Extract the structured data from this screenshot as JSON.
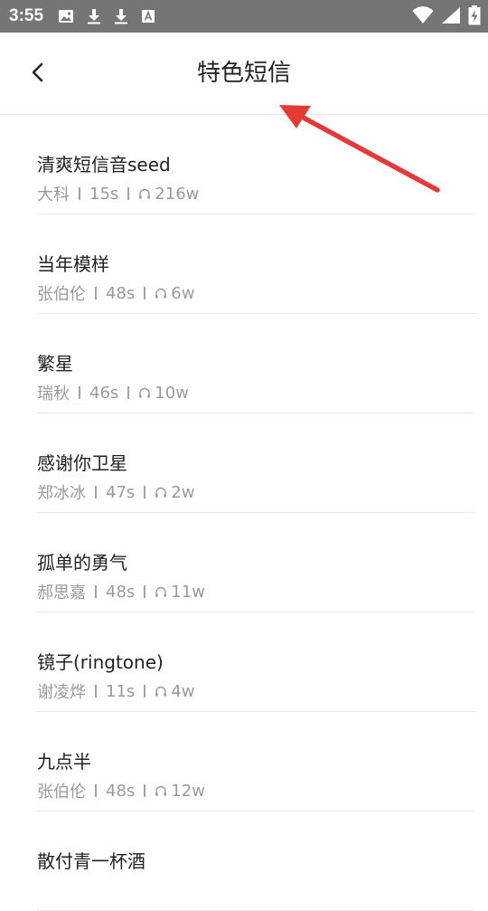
{
  "status_bar": {
    "time": "3:55",
    "left_icons": [
      "image-icon",
      "download-icon",
      "download-icon",
      "font-icon"
    ],
    "right_icons": [
      "wifi-icon",
      "signal-icon",
      "battery-charging-icon"
    ],
    "color": "#757575"
  },
  "header": {
    "title": "特色短信",
    "back_icon": "chevron-left-icon"
  },
  "list": {
    "items": [
      {
        "title": "清爽短信音seed",
        "artist": "大科",
        "duration": "15s",
        "plays": "216w"
      },
      {
        "title": "当年模样",
        "artist": "张伯伦",
        "duration": "48s",
        "plays": "6w"
      },
      {
        "title": "繁星",
        "artist": "瑞秋",
        "duration": "46s",
        "plays": "10w"
      },
      {
        "title": "感谢你卫星",
        "artist": "郑冰冰",
        "duration": "47s",
        "plays": "2w"
      },
      {
        "title": "孤单的勇气",
        "artist": "郝思嘉",
        "duration": "48s",
        "plays": "11w"
      },
      {
        "title": "镜子(ringtone)",
        "artist": "谢凌烨",
        "duration": "11s",
        "plays": "4w"
      },
      {
        "title": "九点半",
        "artist": "张伯伦",
        "duration": "48s",
        "plays": "12w"
      },
      {
        "title": "散付青一杯酒",
        "artist": "",
        "duration": "",
        "plays": ""
      }
    ]
  },
  "annotation": {
    "arrow_color": "#e53935"
  }
}
